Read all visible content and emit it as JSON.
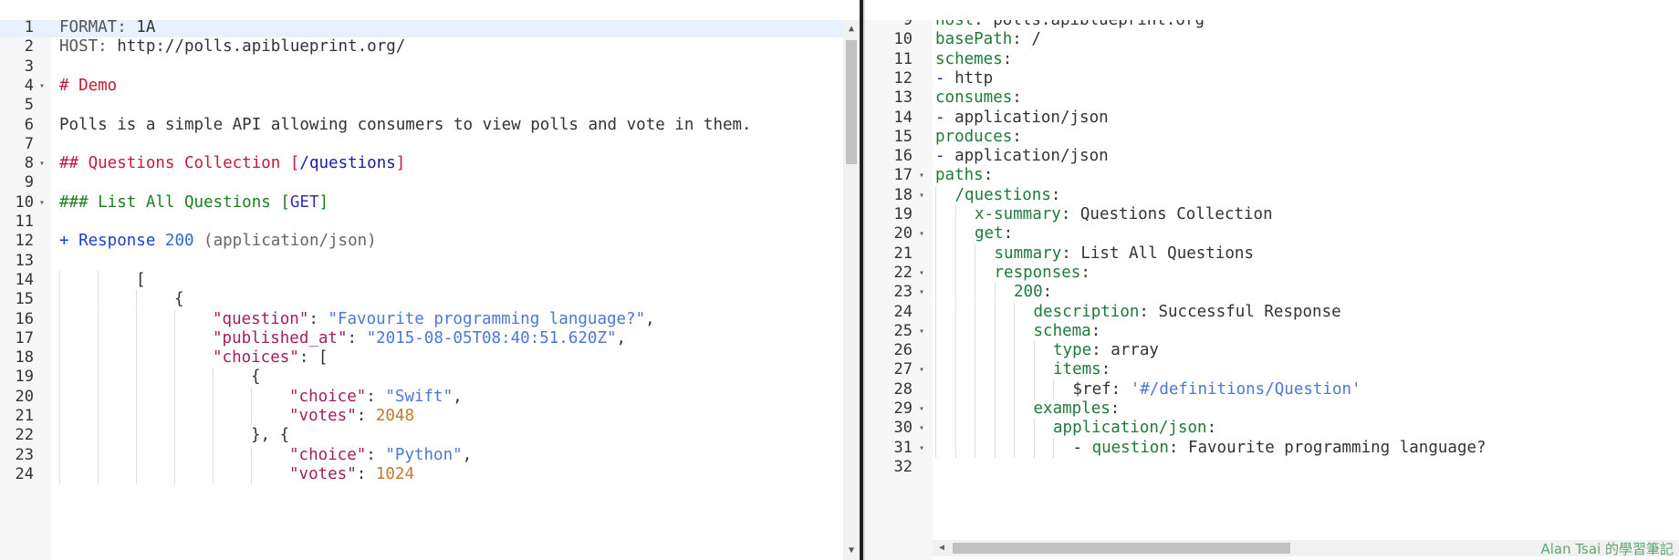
{
  "left_editor": {
    "lines": [
      {
        "n": "1",
        "fold": false,
        "indent": 0,
        "tokens": [
          [
            "t-meta",
            "FORMAT: "
          ],
          [
            "",
            "1A"
          ]
        ]
      },
      {
        "n": "2",
        "fold": false,
        "indent": 0,
        "tokens": [
          [
            "t-meta",
            "HOST: "
          ],
          [
            "",
            "http://polls.apiblueprint.org/"
          ]
        ]
      },
      {
        "n": "3",
        "fold": false,
        "indent": 0,
        "tokens": []
      },
      {
        "n": "4",
        "fold": true,
        "indent": 0,
        "tokens": [
          [
            "t-heading",
            "# Demo"
          ]
        ]
      },
      {
        "n": "5",
        "fold": false,
        "indent": 0,
        "tokens": []
      },
      {
        "n": "6",
        "fold": false,
        "indent": 0,
        "tokens": [
          [
            "",
            "Polls is a simple API allowing consumers to view polls and vote in them."
          ]
        ]
      },
      {
        "n": "7",
        "fold": false,
        "indent": 0,
        "tokens": []
      },
      {
        "n": "8",
        "fold": true,
        "indent": 0,
        "tokens": [
          [
            "t-heading",
            "## Questions Collection "
          ],
          [
            "t-heading",
            "["
          ],
          [
            "t-link",
            "/questions"
          ],
          [
            "t-heading",
            "]"
          ]
        ]
      },
      {
        "n": "9",
        "fold": false,
        "indent": 0,
        "tokens": []
      },
      {
        "n": "10",
        "fold": true,
        "indent": 0,
        "tokens": [
          [
            "t-heading3",
            "### List All Questions "
          ],
          [
            "t-heading3",
            "["
          ],
          [
            "t-method",
            "GET"
          ],
          [
            "t-heading3",
            "]"
          ]
        ]
      },
      {
        "n": "11",
        "fold": false,
        "indent": 0,
        "tokens": []
      },
      {
        "n": "12",
        "fold": false,
        "indent": 0,
        "tokens": [
          [
            "t-plus",
            "+ Response "
          ],
          [
            "t-num",
            "200"
          ],
          [
            "t-muted",
            " (application/json)"
          ]
        ]
      },
      {
        "n": "13",
        "fold": false,
        "indent": 0,
        "tokens": []
      },
      {
        "n": "14",
        "fold": false,
        "indent": 2,
        "tokens": [
          [
            "",
            "["
          ]
        ]
      },
      {
        "n": "15",
        "fold": false,
        "indent": 3,
        "tokens": [
          [
            "",
            "{"
          ]
        ]
      },
      {
        "n": "16",
        "fold": false,
        "indent": 4,
        "tokens": [
          [
            "t-key",
            "\"question\""
          ],
          [
            "",
            ": "
          ],
          [
            "t-str",
            "\"Favourite programming language?\""
          ],
          [
            "",
            ","
          ]
        ]
      },
      {
        "n": "17",
        "fold": false,
        "indent": 4,
        "tokens": [
          [
            "t-key",
            "\"published_at\""
          ],
          [
            "",
            ": "
          ],
          [
            "t-str",
            "\"2015-08-05T08:40:51.620Z\""
          ],
          [
            "",
            ","
          ]
        ]
      },
      {
        "n": "18",
        "fold": false,
        "indent": 4,
        "tokens": [
          [
            "t-key",
            "\"choices\""
          ],
          [
            "",
            ": ["
          ]
        ]
      },
      {
        "n": "19",
        "fold": false,
        "indent": 5,
        "tokens": [
          [
            "",
            "{"
          ]
        ]
      },
      {
        "n": "20",
        "fold": false,
        "indent": 6,
        "tokens": [
          [
            "t-key",
            "\"choice\""
          ],
          [
            "",
            ": "
          ],
          [
            "t-str",
            "\"Swift\""
          ],
          [
            "",
            ","
          ]
        ]
      },
      {
        "n": "21",
        "fold": false,
        "indent": 6,
        "tokens": [
          [
            "t-key",
            "\"votes\""
          ],
          [
            "",
            ": "
          ],
          [
            "t-numlit",
            "2048"
          ]
        ]
      },
      {
        "n": "22",
        "fold": false,
        "indent": 5,
        "tokens": [
          [
            "",
            "}, {"
          ]
        ]
      },
      {
        "n": "23",
        "fold": false,
        "indent": 6,
        "tokens": [
          [
            "t-key",
            "\"choice\""
          ],
          [
            "",
            ": "
          ],
          [
            "t-str",
            "\"Python\""
          ],
          [
            "",
            ","
          ]
        ]
      },
      {
        "n": "24",
        "fold": false,
        "indent": 6,
        "tokens": [
          [
            "t-key",
            "\"votes\""
          ],
          [
            "",
            ": "
          ],
          [
            "t-numlit",
            "1024"
          ]
        ]
      }
    ]
  },
  "right_editor": {
    "lines": [
      {
        "n": "9",
        "fold": false,
        "indent": 0,
        "tokens": [
          [
            "t-yamlkey",
            "host"
          ],
          [
            "",
            ": polls.apiblueprint.org"
          ]
        ]
      },
      {
        "n": "10",
        "fold": false,
        "indent": 0,
        "tokens": [
          [
            "t-yamlkey",
            "basePath"
          ],
          [
            "",
            ": /"
          ]
        ]
      },
      {
        "n": "11",
        "fold": false,
        "indent": 0,
        "tokens": [
          [
            "t-yamlkey",
            "schemes"
          ],
          [
            "",
            ":"
          ]
        ]
      },
      {
        "n": "12",
        "fold": false,
        "indent": 0,
        "tokens": [
          [
            "t-dash",
            "- "
          ],
          [
            "",
            "http"
          ]
        ]
      },
      {
        "n": "13",
        "fold": false,
        "indent": 0,
        "tokens": [
          [
            "t-yamlkey",
            "consumes"
          ],
          [
            "",
            ":"
          ]
        ]
      },
      {
        "n": "14",
        "fold": false,
        "indent": 0,
        "tokens": [
          [
            "t-dash",
            "- "
          ],
          [
            "",
            "application/json"
          ]
        ]
      },
      {
        "n": "15",
        "fold": false,
        "indent": 0,
        "tokens": [
          [
            "t-yamlkey",
            "produces"
          ],
          [
            "",
            ":"
          ]
        ]
      },
      {
        "n": "16",
        "fold": false,
        "indent": 0,
        "tokens": [
          [
            "t-dash",
            "- "
          ],
          [
            "",
            "application/json"
          ]
        ]
      },
      {
        "n": "17",
        "fold": true,
        "indent": 0,
        "tokens": [
          [
            "t-yamlkey",
            "paths"
          ],
          [
            "",
            ":"
          ]
        ]
      },
      {
        "n": "18",
        "fold": true,
        "indent": 1,
        "tokens": [
          [
            "t-yamlkey",
            "/questions"
          ],
          [
            "",
            ":"
          ]
        ]
      },
      {
        "n": "19",
        "fold": false,
        "indent": 2,
        "tokens": [
          [
            "t-yamlkey",
            "x-summary"
          ],
          [
            "",
            ": Questions Collection"
          ]
        ]
      },
      {
        "n": "20",
        "fold": true,
        "indent": 2,
        "tokens": [
          [
            "t-yamlkey",
            "get"
          ],
          [
            "",
            ":"
          ]
        ]
      },
      {
        "n": "21",
        "fold": false,
        "indent": 3,
        "tokens": [
          [
            "t-yamlkey",
            "summary"
          ],
          [
            "",
            ": List All Questions"
          ]
        ]
      },
      {
        "n": "22",
        "fold": true,
        "indent": 3,
        "tokens": [
          [
            "t-yamlkey",
            "responses"
          ],
          [
            "",
            ":"
          ]
        ]
      },
      {
        "n": "23",
        "fold": true,
        "indent": 4,
        "tokens": [
          [
            "t-yamlkey",
            "200"
          ],
          [
            "",
            ":"
          ]
        ]
      },
      {
        "n": "24",
        "fold": false,
        "indent": 5,
        "tokens": [
          [
            "t-yamlkey",
            "description"
          ],
          [
            "",
            ": Successful Response"
          ]
        ]
      },
      {
        "n": "25",
        "fold": true,
        "indent": 5,
        "tokens": [
          [
            "t-yamlkey",
            "schema"
          ],
          [
            "",
            ":"
          ]
        ]
      },
      {
        "n": "26",
        "fold": false,
        "indent": 6,
        "tokens": [
          [
            "t-yamlkey",
            "type"
          ],
          [
            "",
            ": array"
          ]
        ]
      },
      {
        "n": "27",
        "fold": true,
        "indent": 6,
        "tokens": [
          [
            "t-yamlkey",
            "items"
          ],
          [
            "",
            ":"
          ]
        ]
      },
      {
        "n": "28",
        "fold": false,
        "indent": 7,
        "tokens": [
          [
            "",
            "$ref: "
          ],
          [
            "t-str",
            "'#/definitions/Question'"
          ]
        ]
      },
      {
        "n": "29",
        "fold": true,
        "indent": 5,
        "tokens": [
          [
            "t-yamlkey",
            "examples"
          ],
          [
            "",
            ":"
          ]
        ]
      },
      {
        "n": "30",
        "fold": true,
        "indent": 6,
        "tokens": [
          [
            "t-yamlkey",
            "application/json"
          ],
          [
            "",
            ":"
          ]
        ]
      },
      {
        "n": "31",
        "fold": true,
        "indent": 7,
        "tokens": [
          [
            "t-dash",
            "- "
          ],
          [
            "t-yamlkey",
            "question"
          ],
          [
            "",
            ": Favourite programming language?"
          ]
        ]
      },
      {
        "n": "32",
        "fold": false,
        "indent": 0,
        "tokens": []
      }
    ]
  },
  "icons": {
    "fold": "fold-arrow-icon",
    "scroll_up": "scroll-up-arrow-icon",
    "scroll_down": "scroll-down-arrow-icon",
    "scroll_left": "scroll-left-arrow-icon",
    "scroll_right": "scroll-right-arrow-icon"
  },
  "watermark": "Alan Tsai 的學習筆記"
}
